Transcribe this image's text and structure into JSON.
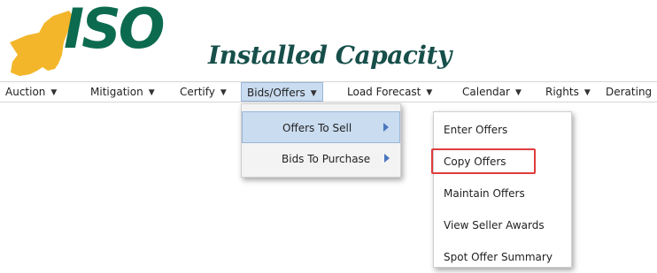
{
  "header": {
    "logo_text": "ISO",
    "product_title": "Installed Capacity"
  },
  "nav": {
    "items": [
      {
        "label": "Auction"
      },
      {
        "label": "Mitigation"
      },
      {
        "label": "Certify"
      },
      {
        "label": "Bids/Offers"
      },
      {
        "label": "Load Forecast"
      },
      {
        "label": "Calendar"
      },
      {
        "label": "Rights"
      },
      {
        "label": "Derating"
      }
    ],
    "active_index": 3
  },
  "menu": {
    "primary": [
      {
        "label": "Offers To Sell",
        "highlighted": true,
        "has_submenu": true
      },
      {
        "label": "Bids To Purchase",
        "highlighted": false,
        "has_submenu": true
      }
    ],
    "secondary": [
      {
        "label": "Enter Offers"
      },
      {
        "label": "Copy Offers",
        "emphasized": true
      },
      {
        "label": "Maintain Offers"
      },
      {
        "label": "View Seller Awards"
      },
      {
        "label": "Spot Offer Summary"
      }
    ]
  },
  "colors": {
    "logo_green": "#0c6b4f",
    "logo_gold": "#f3b62a",
    "menu_highlight": "#c9dcf0",
    "emphasis_box": "#e03c3c"
  }
}
